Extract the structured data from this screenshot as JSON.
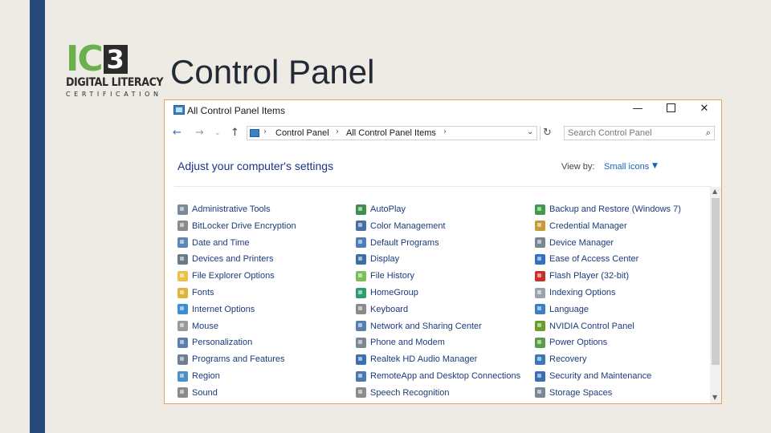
{
  "logo": {
    "ic_letters": "IC",
    "ic_number": "3",
    "line1": "DIGITAL LITERACY",
    "line2": "CERTIFICATION"
  },
  "slide": {
    "title": "Control Panel"
  },
  "window": {
    "title": "All Control Panel Items",
    "buttons": {
      "minimize": "—",
      "maximize": "",
      "close": "✕"
    }
  },
  "nav": {
    "back": "←",
    "forward": "→",
    "recent": "⌄",
    "up": "↑",
    "breadcrumb": [
      "Control Panel",
      "All Control Panel Items"
    ],
    "separator": "›",
    "dropdown": "⌄",
    "refresh": "↻",
    "search_placeholder": "Search Control Panel",
    "search_icon": "⌕"
  },
  "header": {
    "heading": "Adjust your computer's settings",
    "view_by_label": "View by:",
    "view_by_value": "Small icons",
    "view_by_caret": "▼"
  },
  "columns": [
    [
      {
        "label": "Administrative Tools",
        "icon": "admin-tools-icon",
        "color": "#7a8a99"
      },
      {
        "label": "BitLocker Drive Encryption",
        "icon": "bitlocker-icon",
        "color": "#8c8c8c"
      },
      {
        "label": "Date and Time",
        "icon": "clock-icon",
        "color": "#5b87b8"
      },
      {
        "label": "Devices and Printers",
        "icon": "printer-icon",
        "color": "#6b7a8a"
      },
      {
        "label": "File Explorer Options",
        "icon": "folder-icon",
        "color": "#e8c04a"
      },
      {
        "label": "Fonts",
        "icon": "fonts-icon",
        "color": "#e0b43a"
      },
      {
        "label": "Internet Options",
        "icon": "internet-icon",
        "color": "#3d8fd1"
      },
      {
        "label": "Mouse",
        "icon": "mouse-icon",
        "color": "#9a9a9a"
      },
      {
        "label": "Personalization",
        "icon": "personalization-icon",
        "color": "#5a7fb0"
      },
      {
        "label": "Programs and Features",
        "icon": "programs-icon",
        "color": "#6c7f93"
      },
      {
        "label": "Region",
        "icon": "globe-icon",
        "color": "#4a90c8"
      },
      {
        "label": "Sound",
        "icon": "speaker-icon",
        "color": "#8a8a8a"
      }
    ],
    [
      {
        "label": "AutoPlay",
        "icon": "autoplay-icon",
        "color": "#3f8f4f"
      },
      {
        "label": "Color Management",
        "icon": "color-management-icon",
        "color": "#4a6fa5"
      },
      {
        "label": "Default Programs",
        "icon": "default-programs-icon",
        "color": "#4e7fb5"
      },
      {
        "label": "Display",
        "icon": "display-icon",
        "color": "#3a6ea5"
      },
      {
        "label": "File History",
        "icon": "file-history-icon",
        "color": "#7bbf5a"
      },
      {
        "label": "HomeGroup",
        "icon": "homegroup-icon",
        "color": "#2f9e6e"
      },
      {
        "label": "Keyboard",
        "icon": "keyboard-icon",
        "color": "#8a8a8a"
      },
      {
        "label": "Network and Sharing Center",
        "icon": "network-icon",
        "color": "#5580b0"
      },
      {
        "label": "Phone and Modem",
        "icon": "phone-icon",
        "color": "#7d8896"
      },
      {
        "label": "Realtek HD Audio Manager",
        "icon": "audio-manager-icon",
        "color": "#3b6fb0"
      },
      {
        "label": "RemoteApp and Desktop Connections",
        "icon": "remote-app-icon",
        "color": "#4a79b0"
      },
      {
        "label": "Speech Recognition",
        "icon": "microphone-icon",
        "color": "#8c8c8c"
      }
    ],
    [
      {
        "label": "Backup and Restore (Windows 7)",
        "icon": "backup-icon",
        "color": "#3f9a4e"
      },
      {
        "label": "Credential Manager",
        "icon": "credential-icon",
        "color": "#c89a3a"
      },
      {
        "label": "Device Manager",
        "icon": "device-manager-icon",
        "color": "#7a8694"
      },
      {
        "label": "Ease of Access Center",
        "icon": "ease-of-access-icon",
        "color": "#2f72c4"
      },
      {
        "label": "Flash Player (32-bit)",
        "icon": "flash-icon",
        "color": "#c8302a"
      },
      {
        "label": "Indexing Options",
        "icon": "indexing-icon",
        "color": "#9aa4ae"
      },
      {
        "label": "Language",
        "icon": "language-icon",
        "color": "#3b7fc4"
      },
      {
        "label": "NVIDIA Control Panel",
        "icon": "nvidia-icon",
        "color": "#6a9e2a"
      },
      {
        "label": "Power Options",
        "icon": "power-icon",
        "color": "#5a9e4a"
      },
      {
        "label": "Recovery",
        "icon": "recovery-icon",
        "color": "#3a78b8"
      },
      {
        "label": "Security and Maintenance",
        "icon": "flag-icon",
        "color": "#3a6fb5"
      },
      {
        "label": "Storage Spaces",
        "icon": "storage-icon",
        "color": "#7b8794"
      }
    ]
  ],
  "scrollbar": {
    "up": "▲",
    "down": "▼"
  }
}
